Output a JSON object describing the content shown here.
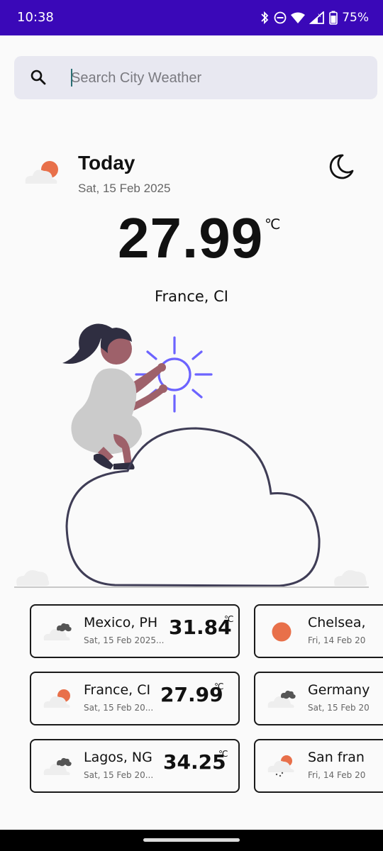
{
  "status_bar": {
    "time": "10:38",
    "battery": "75%",
    "icons": [
      "bluetooth-icon",
      "do-not-disturb-icon",
      "wifi-icon",
      "signal-icon",
      "battery-icon"
    ]
  },
  "search": {
    "placeholder": "Search City Weather",
    "value": ""
  },
  "today": {
    "title": "Today",
    "date": "Sat, 15 Feb 2025",
    "temperature": "27.99",
    "unit": "℃",
    "location": "France, CI",
    "weather_icon": "cloud-sun-icon",
    "theme_toggle_icon": "moon-icon"
  },
  "cities": [
    {
      "city": "Mexico, PH",
      "date": "Sat, 15 Feb 2025...",
      "temp": "31.84",
      "unit": "℃",
      "icon": "dark-cloud-icon"
    },
    {
      "city": "Chelsea,",
      "date": "Fri, 14 Feb 20",
      "temp": "",
      "unit": "",
      "icon": "sun-icon"
    },
    {
      "city": "France, CI",
      "date": "Sat, 15 Feb 20...",
      "temp": "27.99",
      "unit": "℃",
      "icon": "cloud-sun-icon"
    },
    {
      "city": "Germany",
      "date": "Sat, 15 Feb 20",
      "temp": "",
      "unit": "",
      "icon": "dark-cloud-icon"
    },
    {
      "city": "Lagos, NG",
      "date": "Sat, 15 Feb 20...",
      "temp": "34.25",
      "unit": "℃",
      "icon": "dark-cloud-icon"
    },
    {
      "city": "San fran",
      "date": "Fri, 14 Feb 20",
      "temp": "",
      "unit": "",
      "icon": "cloud-sun-rain-icon"
    }
  ],
  "colors": {
    "status_bar": "#3a08b8",
    "accent_sun": "#e8704a",
    "illustration_sun": "#6c63ff",
    "search_bg": "#e8e8f1"
  }
}
